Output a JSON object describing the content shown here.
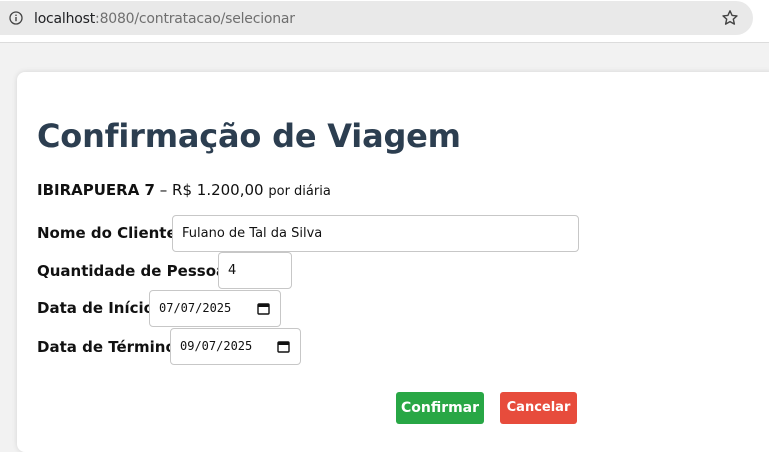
{
  "browser": {
    "url_host": "localhost",
    "url_rest": ":8080/contratacao/selecionar"
  },
  "page": {
    "title": "Confirmação de Viagem",
    "product": {
      "name": "IBIRAPUERA 7",
      "separator": " – R$ ",
      "price": "1.200,00",
      "unit": "por diária"
    }
  },
  "form": {
    "cliente_label": "Nome do Cliente:",
    "cliente_value": "Fulano de Tal da Silva",
    "pessoas_label": "Quantidade de Pessoas:",
    "pessoas_value": "4",
    "inicio_label": "Data de Início:",
    "inicio_value": "07/07/2025",
    "termino_label": "Data de Término:",
    "termino_value": "09/07/2025"
  },
  "actions": {
    "confirm_label": "Confirmar",
    "cancel_label": "Cancelar"
  },
  "colors": {
    "title": "#2c3e50",
    "confirm": "#28a745",
    "cancel": "#e74c3c"
  },
  "icons": {
    "site_info": "info-icon",
    "bookmark": "star-icon",
    "date_picker": "calendar-icon"
  }
}
